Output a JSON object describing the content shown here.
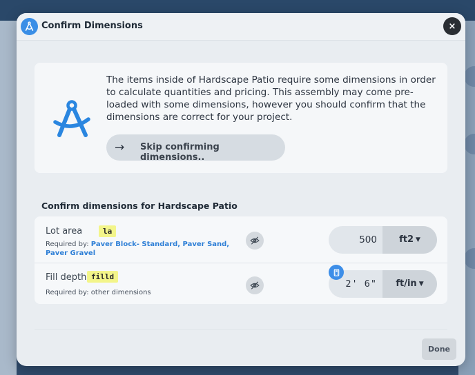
{
  "modal": {
    "title": "Confirm Dimensions",
    "header_icon": "compass-icon",
    "close_icon": "close-icon",
    "close_symbol": "×"
  },
  "info": {
    "illustration": "compass-icon",
    "text": "The items inside of Hardscape Patio require some dimensions in order to calculate quantities and pricing. This assembly may come pre-loaded with some dimensions, however you should confirm that the dimensions are correct for your project.",
    "skip_icon": "arrow-right-icon",
    "skip_arrow": "→",
    "skip_label": "Skip confirming dimensions.."
  },
  "section_title": "Confirm dimensions for Hardscape Patio",
  "dimensions": [
    {
      "label": "Lot area",
      "code": "la",
      "required_prefix": "Required by: ",
      "required_by": "Paver Block- Standard, Paver Sand, Paver Gravel",
      "visibility_icon": "eye-off-icon",
      "value": "500",
      "unit": "ft2",
      "unit_caret": "▼"
    },
    {
      "label": "Fill depth",
      "code": "filld",
      "required_prefix": "Required by: ",
      "required_by": "other dimensions",
      "visibility_icon": "eye-off-icon",
      "calc_icon": "calculator-icon",
      "value": "2' 6\"",
      "unit": "ft/in",
      "unit_caret": "▼"
    }
  ],
  "footer": {
    "done_label": "Done"
  },
  "colors": {
    "accent": "#3a8ee6",
    "link": "#2e7fd6",
    "code_highlight": "#f3f58a"
  }
}
